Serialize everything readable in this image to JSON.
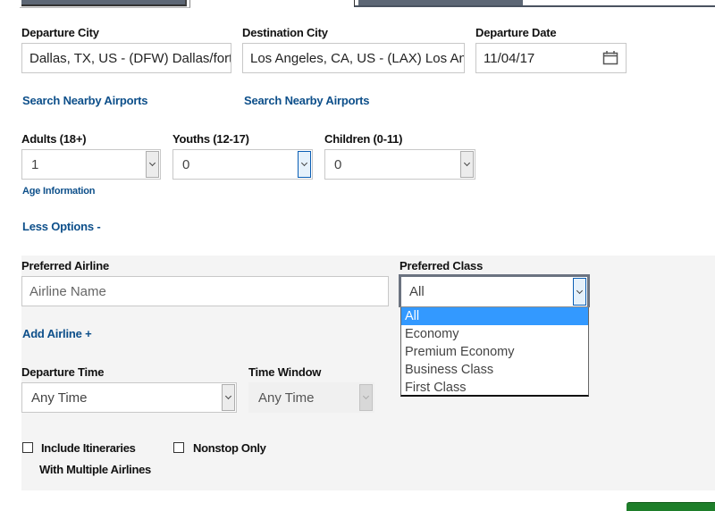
{
  "tabs": [
    {
      "label": "",
      "name": "tab-round-trip"
    },
    {
      "label": "",
      "name": "tab-one-way"
    }
  ],
  "departure_city": {
    "label": "Departure City",
    "value": "Dallas, TX, US - (DFW) Dallas/fort",
    "nearby_link": "Search Nearby Airports"
  },
  "destination_city": {
    "label": "Destination City",
    "value": "Los Angeles, CA, US - (LAX) Los Ang",
    "nearby_link": "Search Nearby Airports"
  },
  "departure_date": {
    "label": "Departure Date",
    "value": "11/04/17",
    "icon": "calendar-icon"
  },
  "passengers": {
    "adults": {
      "label": "Adults (18+)",
      "value": "1"
    },
    "youths": {
      "label": "Youths (12-17)",
      "value": "0"
    },
    "children": {
      "label": "Children (0-11)",
      "value": "0"
    },
    "age_info_link": "Age Information"
  },
  "less_options_link": "Less Options -",
  "preferred_airline": {
    "label": "Preferred Airline",
    "placeholder": "Airline Name",
    "add_link": "Add Airline +"
  },
  "preferred_class": {
    "label": "Preferred Class",
    "value": "All",
    "options": [
      "All",
      "Economy",
      "Premium Economy",
      "Business Class",
      "First Class"
    ],
    "selected_index": 0
  },
  "departure_time": {
    "label": "Departure Time",
    "value": "Any Time"
  },
  "time_window": {
    "label": "Time Window",
    "value": "Any Time",
    "disabled": true
  },
  "checkboxes": {
    "multiple_airlines": {
      "label_line1": "Include Itineraries",
      "label_line2": "With Multiple Airlines",
      "checked": false
    },
    "nonstop": {
      "label": "Nonstop Only",
      "checked": false
    }
  },
  "colors": {
    "link": "#0d4f8a",
    "tab": "#5d6775",
    "highlight": "#3399ff",
    "panel_bg": "#f4f4f4",
    "search_button": "#1e7e2a"
  }
}
